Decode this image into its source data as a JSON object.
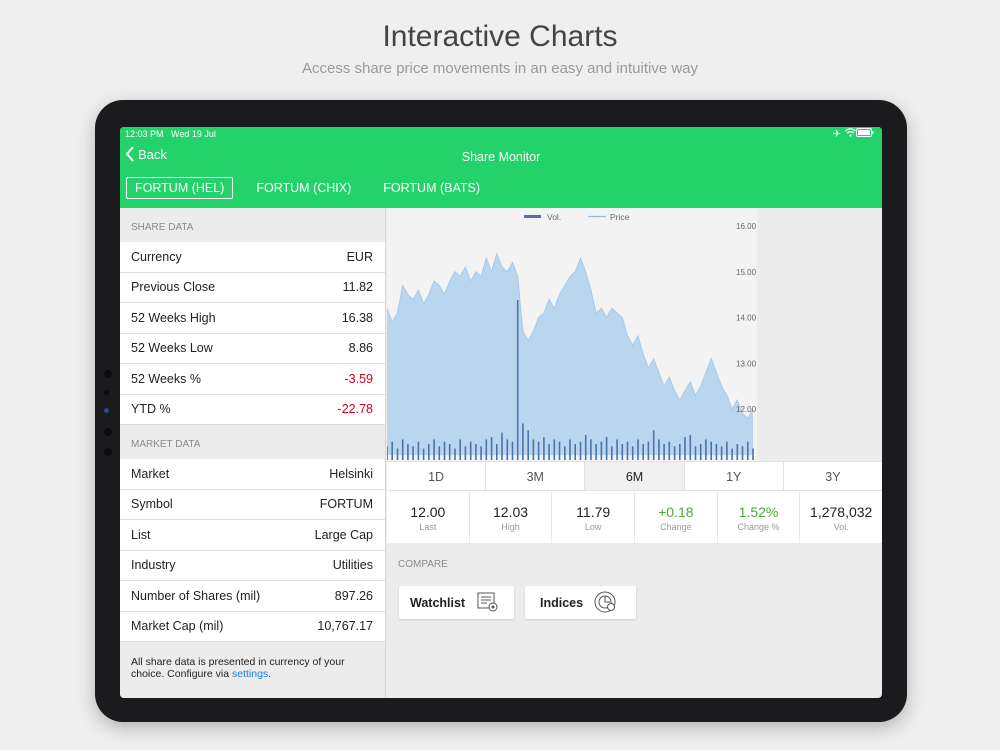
{
  "promo": {
    "title": "Interactive Charts",
    "subtitle": "Access share price movements in an easy and intuitive way"
  },
  "status_bar": {
    "time": "12:03 PM",
    "date": "Wed 19 Jul",
    "icons": [
      "airplane-icon",
      "wifi-icon",
      "battery-icon"
    ]
  },
  "nav": {
    "back_label": "Back",
    "title": "Share Monitor"
  },
  "exchange_tabs": [
    {
      "label": "FORTUM (HEL)",
      "active": true
    },
    {
      "label": "FORTUM (CHIX)",
      "active": false
    },
    {
      "label": "FORTUM (BATS)",
      "active": false
    }
  ],
  "share_data": {
    "heading": "SHARE DATA",
    "rows": [
      {
        "label": "Currency",
        "value": "EUR",
        "negative": false
      },
      {
        "label": "Previous Close",
        "value": "11.82",
        "negative": false
      },
      {
        "label": "52 Weeks High",
        "value": "16.38",
        "negative": false
      },
      {
        "label": "52 Weeks Low",
        "value": "8.86",
        "negative": false
      },
      {
        "label": "52 Weeks %",
        "value": "-3.59",
        "negative": true
      },
      {
        "label": "YTD %",
        "value": "-22.78",
        "negative": true
      }
    ]
  },
  "market_data": {
    "heading": "MARKET DATA",
    "rows": [
      {
        "label": "Market",
        "value": "Helsinki"
      },
      {
        "label": "Symbol",
        "value": "FORTUM"
      },
      {
        "label": "List",
        "value": "Large Cap"
      },
      {
        "label": "Industry",
        "value": "Utilities"
      },
      {
        "label": "Number of Shares (mil)",
        "value": "897.26"
      },
      {
        "label": "Market Cap (mil)",
        "value": "10,767.17"
      }
    ]
  },
  "footnote": {
    "text": "All share data is presented in currency of your choice. Configure via ",
    "link": "settings",
    "end": "."
  },
  "periods": [
    {
      "label": "1D",
      "active": false
    },
    {
      "label": "3M",
      "active": false
    },
    {
      "label": "6M",
      "active": true
    },
    {
      "label": "1Y",
      "active": false
    },
    {
      "label": "3Y",
      "active": false
    }
  ],
  "stats": [
    {
      "value": "12.00",
      "label": "Last",
      "positive": false
    },
    {
      "value": "12.03",
      "label": "High",
      "positive": false
    },
    {
      "value": "11.79",
      "label": "Low",
      "positive": false
    },
    {
      "value": "+0.18",
      "label": "Change",
      "positive": true
    },
    {
      "value": "1.52%",
      "label": "Change %",
      "positive": true
    },
    {
      "value": "1,278,032",
      "label": "Vol.",
      "positive": false
    }
  ],
  "compare": {
    "heading": "COMPARE",
    "buttons": [
      {
        "label": "Watchlist",
        "icon": "watchlist-icon"
      },
      {
        "label": "Indices",
        "icon": "indices-icon"
      }
    ]
  },
  "colors": {
    "green": "#23d369",
    "negative": "#d0021b",
    "positive": "#4caa3a",
    "price_fill": "#b9d6ee",
    "volume": "#4a73a8",
    "link": "#1a7ee6"
  },
  "chart_data": {
    "type": "area",
    "legend": [
      "Vol.",
      "Price"
    ],
    "legend_position": "top",
    "ylim": [
      11.0,
      16.0
    ],
    "y_ticks": [
      "16.00",
      "15.00",
      "14.00",
      "13.00",
      "12.00"
    ],
    "y_tick_values": [
      16,
      15,
      14,
      13,
      12
    ],
    "series": [
      {
        "name": "Price",
        "values": [
          14.2,
          13.9,
          14.1,
          14.7,
          14.5,
          14.4,
          14.6,
          14.3,
          14.5,
          14.8,
          14.7,
          14.5,
          14.8,
          15.0,
          14.9,
          15.1,
          14.8,
          15.0,
          14.9,
          15.3,
          15.0,
          15.4,
          15.1,
          15.0,
          15.2,
          14.9,
          13.7,
          13.5,
          13.7,
          14.0,
          14.1,
          14.4,
          14.2,
          14.5,
          14.7,
          14.9,
          15.0,
          15.3,
          15.0,
          14.6,
          14.1,
          14.2,
          14.0,
          14.2,
          14.1,
          14.0,
          13.6,
          13.4,
          13.6,
          13.2,
          12.9,
          13.1,
          12.8,
          12.5,
          12.7,
          12.4,
          12.2,
          12.4,
          12.6,
          12.3,
          12.5,
          12.8,
          13.1,
          12.8,
          12.5,
          12.3,
          12.0,
          12.2,
          11.9,
          11.8,
          12.0
        ]
      },
      {
        "name": "Vol.",
        "values": [
          0.6,
          0.8,
          0.5,
          0.9,
          0.7,
          0.6,
          0.8,
          0.5,
          0.7,
          0.9,
          0.6,
          0.8,
          0.7,
          0.5,
          0.9,
          0.6,
          0.8,
          0.7,
          0.6,
          0.9,
          1.0,
          0.7,
          1.2,
          0.9,
          0.8,
          7.0,
          1.6,
          1.3,
          0.9,
          0.8,
          1.0,
          0.7,
          0.9,
          0.8,
          0.6,
          0.9,
          0.7,
          0.8,
          1.1,
          0.9,
          0.7,
          0.8,
          1.0,
          0.6,
          0.9,
          0.7,
          0.8,
          0.6,
          0.9,
          0.7,
          0.8,
          1.3,
          0.9,
          0.7,
          0.8,
          0.6,
          0.7,
          1.0,
          1.1,
          0.6,
          0.7,
          0.9,
          0.8,
          0.7,
          0.6,
          0.8,
          0.5,
          0.7,
          0.6,
          0.8,
          0.5
        ]
      }
    ]
  }
}
